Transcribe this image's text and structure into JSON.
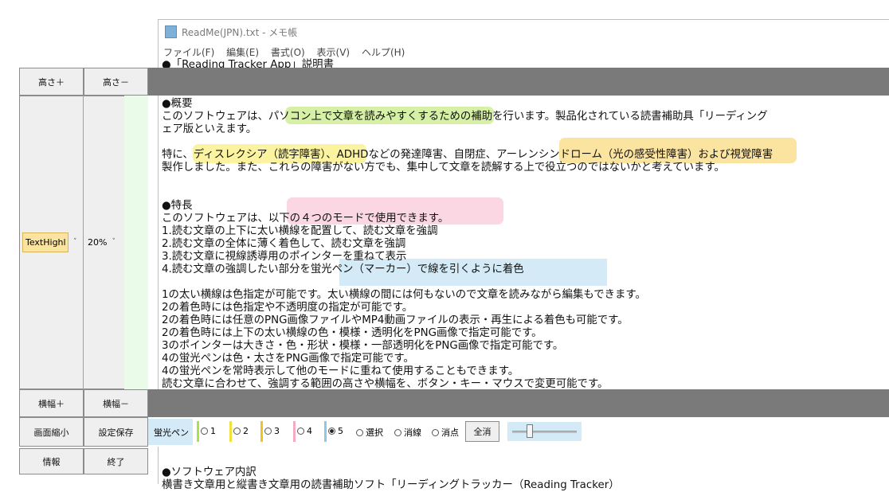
{
  "notepad": {
    "title": "ReadMe(JPN).txt - メモ帳",
    "menu": [
      "ファイル(F)",
      "編集(E)",
      "書式(O)",
      "表示(V)",
      "ヘルプ(H)"
    ],
    "top_line": "●「Reading Tracker App」説明書",
    "lines": [
      "●概要",
      "このソフトウェアは、パソコン上で文章を読みやすくするための補助を行います。製品化されている読書補助具「リーディング",
      "ェア版といえます。",
      "",
      "特に、ディスレクシア（読字障害）、ADHDなどの発達障害、自閉症、アーレンシンドローム（光の感受性障害）および視覚障害",
      "製作しました。また、これらの障害がない方でも、集中して文章を読解する上で役立つのではないかと考えています。",
      "",
      "",
      "●特長",
      "このソフトウェアは、以下の４つのモードで使用できます。",
      "1.読む文章の上下に太い横線を配置して、読む文章を強調",
      "2.読む文章の全体に薄く着色して、読む文章を強調",
      "3.読む文章に視線誘導用のポインターを重ねて表示",
      "4.読む文章の強調したい部分を蛍光ペン（マーカー）で線を引くように着色",
      "",
      "1の太い横線は色指定が可能です。太い横線の間には何もないので文章を読みながら編集もできます。",
      "2の着色時には色指定や不透明度の指定が可能です。",
      "2の着色時には任意のPNG画像ファイルやMP4動画ファイルの表示・再生による着色も可能です。",
      "2の着色時には上下の太い横線の色・模様・透明化をPNG画像で指定可能です。",
      "3のポインターは大きさ・色・形状・模様・一部透明化をPNG画像で指定可能です。",
      "4の蛍光ペンは色・太さをPNG画像で指定可能です。",
      "4の蛍光ペンを常時表示して他のモードに重ねて使用することもできます。",
      "読む文章に合わせて、強調する範囲の高さや横幅を、ボタン・キー・マウスで変更可能です。"
    ],
    "bottom_line": "●ソフトウェア内訳",
    "bottom_partial": "横書き文章用と縦書き文章用の読書補助ソフト「リーディングトラッカー（Reading Tracker）"
  },
  "panel": {
    "height_plus": "高さ＋",
    "height_minus": "高さ－",
    "mode_select": "TextHighl",
    "opacity_select": "20%",
    "width_plus": "横幅＋",
    "width_minus": "横幅－",
    "shrink_screen": "画面縮小",
    "save_settings": "設定保存",
    "info": "情報",
    "exit": "終了"
  },
  "highlighter_toolbar": {
    "label": "蛍光ペン",
    "options": [
      {
        "label": "1",
        "color": "#a7e14d",
        "selected": false
      },
      {
        "label": "2",
        "color": "#f0e23a",
        "selected": false
      },
      {
        "label": "3",
        "color": "#f2c31e",
        "selected": false
      },
      {
        "label": "4",
        "color": "#f4a9c5",
        "selected": false
      },
      {
        "label": "5",
        "color": "#8fc8e6",
        "selected": true
      }
    ],
    "select_label": "選択",
    "erase_line_label": "消線",
    "erase_point_label": "消点",
    "erase_all_label": "全消"
  }
}
